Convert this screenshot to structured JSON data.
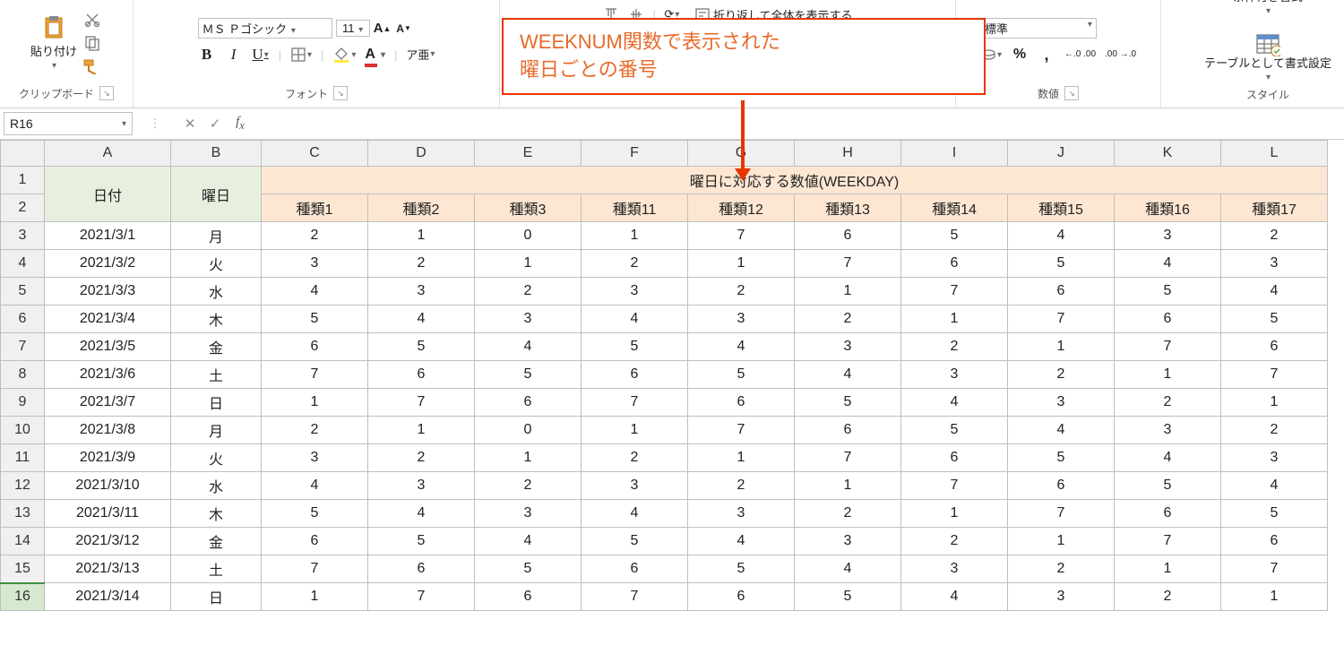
{
  "ribbon": {
    "clipboard": {
      "label": "クリップボード",
      "paste_label": "貼り付け"
    },
    "font": {
      "label": "フォント",
      "name": "ＭＳ Ｐゴシック",
      "size": "11",
      "bold": "B",
      "italic": "I",
      "underline": "U",
      "ruby": "ア亜"
    },
    "number": {
      "label": "数値",
      "format": "標準",
      "percent": "%",
      "comma": ",",
      "inc": "←.0 .00",
      "dec": ".00 →.0"
    },
    "styles": {
      "label": "スタイル",
      "cond": "条件付き書式",
      "table": "テーブルとして書式設定"
    },
    "alignment": {
      "wrap": "折り返して全体を表示する"
    }
  },
  "callout": {
    "line1": "WEEKNUM関数で表示された",
    "line2": "曜日ごとの番号"
  },
  "namebox": "R16",
  "formula": "",
  "columns": [
    "A",
    "B",
    "C",
    "D",
    "E",
    "F",
    "G",
    "H",
    "I",
    "J",
    "K",
    "L"
  ],
  "header": {
    "date": "日付",
    "day": "曜日",
    "group": "曜日に対応する数値(WEEKDAY)",
    "types": [
      "種類1",
      "種類2",
      "種類3",
      "種類11",
      "種類12",
      "種類13",
      "種類14",
      "種類15",
      "種類16",
      "種類17"
    ]
  },
  "rows": [
    {
      "n": 3,
      "date": "2021/3/1",
      "day": "月",
      "v": [
        2,
        1,
        0,
        1,
        7,
        6,
        5,
        4,
        3,
        2
      ]
    },
    {
      "n": 4,
      "date": "2021/3/2",
      "day": "火",
      "v": [
        3,
        2,
        1,
        2,
        1,
        7,
        6,
        5,
        4,
        3
      ]
    },
    {
      "n": 5,
      "date": "2021/3/3",
      "day": "水",
      "v": [
        4,
        3,
        2,
        3,
        2,
        1,
        7,
        6,
        5,
        4
      ]
    },
    {
      "n": 6,
      "date": "2021/3/4",
      "day": "木",
      "v": [
        5,
        4,
        3,
        4,
        3,
        2,
        1,
        7,
        6,
        5
      ]
    },
    {
      "n": 7,
      "date": "2021/3/5",
      "day": "金",
      "v": [
        6,
        5,
        4,
        5,
        4,
        3,
        2,
        1,
        7,
        6
      ]
    },
    {
      "n": 8,
      "date": "2021/3/6",
      "day": "土",
      "v": [
        7,
        6,
        5,
        6,
        5,
        4,
        3,
        2,
        1,
        7
      ]
    },
    {
      "n": 9,
      "date": "2021/3/7",
      "day": "日",
      "v": [
        1,
        7,
        6,
        7,
        6,
        5,
        4,
        3,
        2,
        1
      ]
    },
    {
      "n": 10,
      "date": "2021/3/8",
      "day": "月",
      "v": [
        2,
        1,
        0,
        1,
        7,
        6,
        5,
        4,
        3,
        2
      ]
    },
    {
      "n": 11,
      "date": "2021/3/9",
      "day": "火",
      "v": [
        3,
        2,
        1,
        2,
        1,
        7,
        6,
        5,
        4,
        3
      ]
    },
    {
      "n": 12,
      "date": "2021/3/10",
      "day": "水",
      "v": [
        4,
        3,
        2,
        3,
        2,
        1,
        7,
        6,
        5,
        4
      ]
    },
    {
      "n": 13,
      "date": "2021/3/11",
      "day": "木",
      "v": [
        5,
        4,
        3,
        4,
        3,
        2,
        1,
        7,
        6,
        5
      ]
    },
    {
      "n": 14,
      "date": "2021/3/12",
      "day": "金",
      "v": [
        6,
        5,
        4,
        5,
        4,
        3,
        2,
        1,
        7,
        6
      ]
    },
    {
      "n": 15,
      "date": "2021/3/13",
      "day": "土",
      "v": [
        7,
        6,
        5,
        6,
        5,
        4,
        3,
        2,
        1,
        7
      ]
    },
    {
      "n": 16,
      "date": "2021/3/14",
      "day": "日",
      "v": [
        1,
        7,
        6,
        7,
        6,
        5,
        4,
        3,
        2,
        1
      ]
    }
  ]
}
